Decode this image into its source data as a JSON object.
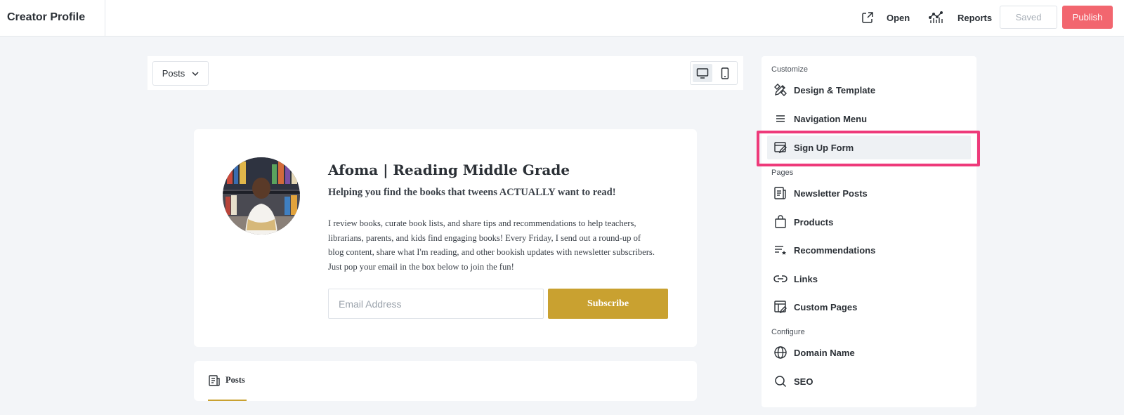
{
  "header": {
    "title": "Creator Profile",
    "open_label": "Open",
    "reports_label": "Reports",
    "saved_label": "Saved",
    "publish_label": "Publish"
  },
  "preview": {
    "dropdown_label": "Posts",
    "profile": {
      "name": "Afoma | Reading Middle Grade",
      "tagline": "Helping you find the books that tweens ACTUALLY want to read!",
      "bio": "I review books, curate book lists, and share tips and recommendations to help teachers, librarians, parents, and kids find engaging books! Every Friday, I send out a round-up of blog content, share what I'm reading, and other bookish updates with newsletter subscribers.  Just pop your email in the box below to join the fun!",
      "email_placeholder": "Email Address",
      "subscribe_label": "Subscribe"
    },
    "posts_tab_label": "Posts"
  },
  "sidebar": {
    "sections": {
      "customize": "Customize",
      "pages": "Pages",
      "configure": "Configure"
    },
    "items": [
      {
        "label": "Design & Template",
        "icon": "design-tools-icon"
      },
      {
        "label": "Navigation Menu",
        "icon": "menu-lines-icon"
      },
      {
        "label": "Sign Up Form",
        "icon": "form-edit-icon",
        "active": true
      },
      {
        "label": "Newsletter Posts",
        "icon": "document-icon"
      },
      {
        "label": "Products",
        "icon": "shopping-bag-icon"
      },
      {
        "label": "Recommendations",
        "icon": "list-star-icon"
      },
      {
        "label": "Links",
        "icon": "link-icon"
      },
      {
        "label": "Custom Pages",
        "icon": "layout-edit-icon"
      },
      {
        "label": "Domain Name",
        "icon": "globe-icon"
      },
      {
        "label": "SEO",
        "icon": "search-icon"
      }
    ]
  },
  "colors": {
    "accent_gold": "#c9a130",
    "publish_red": "#f2666f",
    "highlight_pink": "#ee3a7a"
  }
}
